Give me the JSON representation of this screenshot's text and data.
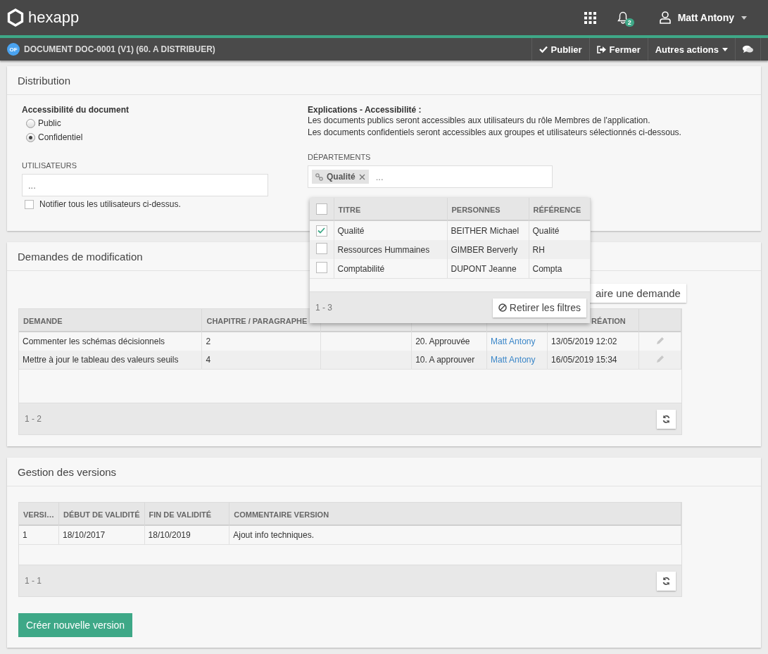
{
  "app": {
    "logo_text": "hexapp",
    "notifications": "2",
    "user": "Matt Antony"
  },
  "document_bar": {
    "badge": "OF",
    "title": "DOCUMENT DOC-0001 (V1) (60. A DISTRIBUER)",
    "actions": [
      {
        "kind": "check",
        "label": "Publier"
      },
      {
        "kind": "exit",
        "label": "Fermer"
      },
      {
        "kind": "menu",
        "label": "Autres actions"
      },
      {
        "kind": "chat"
      }
    ]
  },
  "distribution": {
    "title": "Distribution",
    "accessibility_label": "Accessibilité du document",
    "options": [
      {
        "label": "Public",
        "selected": false
      },
      {
        "label": "Confidentiel",
        "selected": true
      }
    ],
    "explanation_title": "Explications - Accessibilité :",
    "explanation_lines": [
      "Les documents publics seront accessibles aux utilisateurs du rôle Membres de l'application.",
      "Les documents confidentiels seront accessibles aux groupes et utilisateurs sélectionnés ci-dessous."
    ],
    "users": {
      "label": "UTILISATEURS",
      "placeholder": "...",
      "notify": {
        "label": "Notifier tous les utilisateurs ci-dessus.",
        "checked": false
      }
    },
    "departments": {
      "label": "DÉPARTEMENTS",
      "tags": [
        "Qualité"
      ],
      "placeholder": "...",
      "dropdown": {
        "all_checked": false,
        "columns": [
          "TITRE",
          "PERSONNES",
          "RÉFÉRENCE"
        ],
        "rows": [
          {
            "titre": "Qualité",
            "personnes": "BEITHER Michael",
            "reference": "Qualité",
            "checked": true
          },
          {
            "titre": "Ressources Hummaines",
            "personnes": "GIMBER Berverly",
            "reference": "RH",
            "checked": false
          },
          {
            "titre": "Comptabilité",
            "personnes": "DUPONT Jeanne",
            "reference": "Compta",
            "checked": false
          }
        ],
        "count": "1 - 3",
        "clear_button": "Retirer les filtres"
      }
    }
  },
  "requests": {
    "title": "Demandes de modification",
    "new_button": "aire une demande",
    "columns": [
      "DEMANDE",
      "CHAPITRE / PARAGRAPHE",
      null,
      null,
      null,
      "RÉATION",
      null
    ],
    "rows": [
      {
        "demande": "Commenter les schémas décisionnels",
        "chapitre_paragraphe": "2",
        "column_4": "20. Approuvée",
        "column_5": "Matt Antony",
        "column_6": "13/05/2019 12:02"
      },
      {
        "demande": "Mettre à jour le tableau des valeurs seuils",
        "chapitre_paragraphe": "4",
        "column_4": "10. A approuver",
        "column_5": "Matt Antony",
        "column_6": "16/05/2019 15:34"
      }
    ],
    "count": "1 - 2"
  },
  "versions": {
    "title": "Gestion des versions",
    "columns": [
      "VERSI…",
      "DÉBUT DE VALIDITÉ",
      "FIN DE VALIDITÉ",
      "COMMENTAIRE VERSION"
    ],
    "rows": [
      [
        "1",
        "18/10/2017",
        "18/10/2019",
        "Ajout info techniques."
      ]
    ],
    "count": "1 - 1",
    "create_button": "Créer nouvelle version"
  }
}
